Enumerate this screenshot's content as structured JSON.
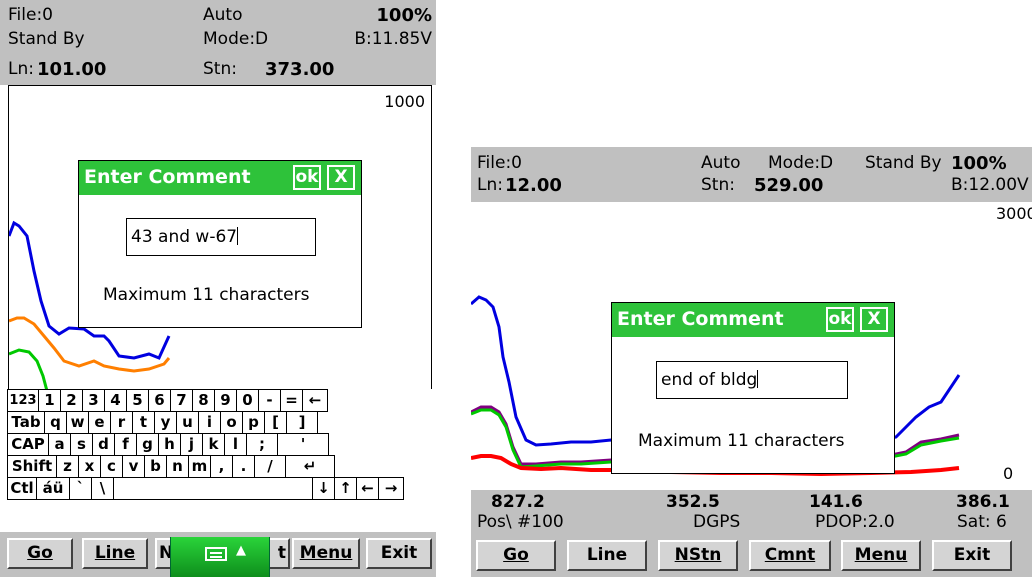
{
  "left_screen": {
    "header": {
      "file": "File:0",
      "auto": "Auto",
      "percent": "100%",
      "state": "Stand By",
      "mode": "Mode:D",
      "battery": "B:11.85V",
      "line_label": "Ln:",
      "line_value": "101.00",
      "station_label": "Stn:",
      "station_value": "373.00"
    },
    "plot": {
      "scale_max": "1000",
      "series_colors": [
        "#0000e0",
        "#ff7f00",
        "#00c800"
      ]
    },
    "dialog": {
      "title": "Enter Comment",
      "ok_label": "ok",
      "close_label": "X",
      "input_value": "43 and w-67",
      "note": "Maximum 11 characters"
    },
    "keyboard": {
      "rows": [
        [
          "123",
          "1",
          "2",
          "3",
          "4",
          "5",
          "6",
          "7",
          "8",
          "9",
          "0",
          "-",
          "=",
          "←"
        ],
        [
          "Tab",
          "q",
          "w",
          "e",
          "r",
          "t",
          "y",
          "u",
          "i",
          "o",
          "p",
          "[",
          "]"
        ],
        [
          "CAP",
          "a",
          "s",
          "d",
          "f",
          "g",
          "h",
          "j",
          "k",
          "l",
          ";",
          "'"
        ],
        [
          "Shift",
          "z",
          "x",
          "c",
          "v",
          "b",
          "n",
          "m",
          ",",
          ".",
          "/",
          "↵"
        ],
        [
          "Ctl",
          "áü",
          "`",
          "\\",
          "",
          "↓",
          "↑",
          "←",
          "→"
        ]
      ]
    },
    "toolbar": {
      "go": "Go",
      "line": "Line",
      "n": "N",
      "t": "t",
      "menu": "Menu",
      "exit": "Exit"
    },
    "sip": {
      "icon": "keyboard-icon",
      "arrow": "▲"
    }
  },
  "right_screen": {
    "header": {
      "file": "File:0",
      "auto": "Auto",
      "mode": "Mode:D",
      "state": "Stand By",
      "percent": "100%",
      "line_label": "Ln:",
      "line_value": "12.00",
      "station_label": "Stn:",
      "station_value": "529.00",
      "battery": "B:12.00V"
    },
    "plot": {
      "scale_max": "3000",
      "scale_min": "0",
      "series_colors": [
        "#0000e0",
        "#800080",
        "#00c800",
        "#ff0000"
      ]
    },
    "dialog": {
      "title": "Enter Comment",
      "ok_label": "ok",
      "close_label": "X",
      "input_value": "end of bldg",
      "note": "Maximum 11 characters"
    },
    "readouts": {
      "v1": "827.2",
      "v2": "352.5",
      "v3": "141.6",
      "v4": "386.1",
      "pos": "Pos\\ #100",
      "dgps": "DGPS",
      "pdop": "PDOP:2.0",
      "sat": "Sat: 6"
    },
    "toolbar": {
      "go": "Go",
      "line": "Line",
      "nstn": "NStn",
      "cmnt": "Cmnt",
      "menu": "Menu",
      "exit": "Exit"
    }
  }
}
